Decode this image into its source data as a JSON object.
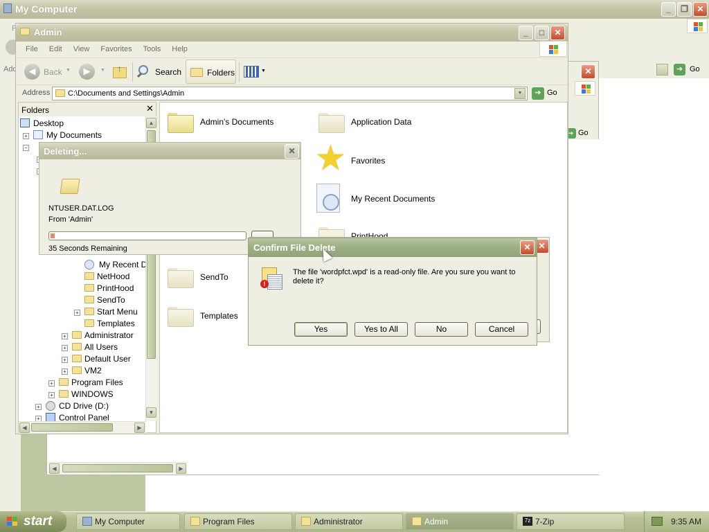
{
  "bg_window": {
    "title": "My Computer",
    "menu_first": "File",
    "address_label": "Add",
    "go_label": "Go"
  },
  "back_window2": {
    "go_label": "Go"
  },
  "explorer": {
    "title": "Admin",
    "menu": [
      "File",
      "Edit",
      "View",
      "Favorites",
      "Tools",
      "Help"
    ],
    "toolbar": {
      "back": "Back",
      "search": "Search",
      "folders": "Folders"
    },
    "address_label": "Address",
    "address_value": "C:\\Documents and Settings\\Admin",
    "go_label": "Go",
    "folders_pane_title": "Folders",
    "tree": [
      {
        "label": "Desktop",
        "icon": "desktop-icon"
      },
      {
        "label": "My Documents",
        "icon": "my-documents-icon"
      },
      {
        "label": "My Recent Do",
        "icon": "recent-documents-icon"
      },
      {
        "label": "NetHood",
        "icon": "folder-icon"
      },
      {
        "label": "PrintHood",
        "icon": "folder-icon"
      },
      {
        "label": "SendTo",
        "icon": "folder-icon"
      },
      {
        "label": "Start Menu",
        "icon": "folder-icon"
      },
      {
        "label": "Templates",
        "icon": "folder-icon"
      },
      {
        "label": "Administrator",
        "icon": "folder-icon"
      },
      {
        "label": "All Users",
        "icon": "folder-icon"
      },
      {
        "label": "Default User",
        "icon": "folder-icon"
      },
      {
        "label": "VM2",
        "icon": "folder-icon"
      },
      {
        "label": "Program Files",
        "icon": "folder-icon"
      },
      {
        "label": "WINDOWS",
        "icon": "folder-icon"
      },
      {
        "label": "CD Drive (D:)",
        "icon": "cd-drive-icon"
      },
      {
        "label": "Control Panel",
        "icon": "control-panel-icon"
      }
    ],
    "items": [
      {
        "label": "Admin's Documents",
        "icon": "folder-icon"
      },
      {
        "label": "Application Data",
        "icon": "folder-icon"
      },
      {
        "label": "Favorites",
        "icon": "favorites-star-icon"
      },
      {
        "label": "My Recent Documents",
        "icon": "recent-documents-icon"
      },
      {
        "label": "PrintHood",
        "icon": "folder-icon"
      },
      {
        "label": "SendTo",
        "icon": "folder-icon"
      },
      {
        "label": "Templates",
        "icon": "folder-icon"
      }
    ]
  },
  "deleting_dialog": {
    "title": "Deleting...",
    "filename": "NTUSER.DAT.LOG",
    "from": "From 'Admin'",
    "remaining": "35 Seconds Remaining",
    "progress": 0.02
  },
  "confirm_dialog": {
    "title": "Confirm File Delete",
    "message": "The file 'wordpfct.wpd' is a read-only file.  Are you sure you want to delete it?",
    "buttons": {
      "yes": "Yes",
      "yes_all": "Yes to All",
      "no": "No",
      "cancel": "Cancel"
    }
  },
  "taskbar": {
    "start": "start",
    "tasks": [
      "My Computer",
      "Program Files",
      "Administrator",
      "Admin",
      "7-Zip"
    ],
    "active_task": "Admin",
    "time": "9:35 AM"
  },
  "colors": {
    "taskbar": "#c0c9a0",
    "title_active": "#9db084",
    "title_inactive": "#c6c6a8",
    "dialog_body": "#efeee2"
  }
}
